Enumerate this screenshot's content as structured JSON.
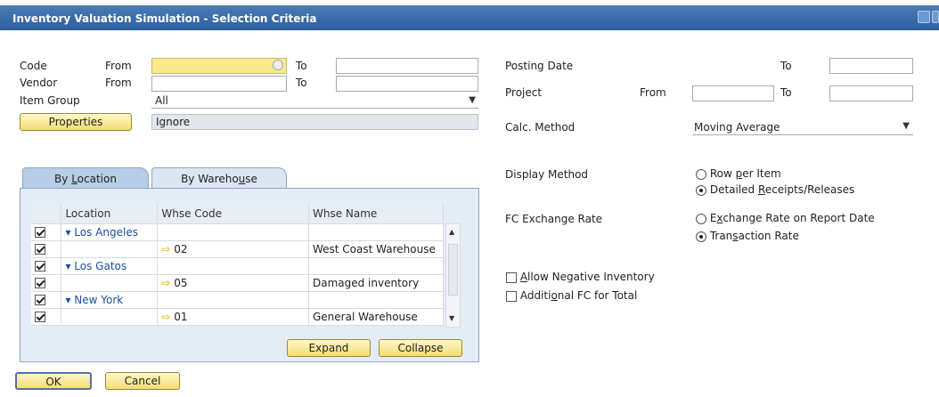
{
  "window": {
    "title": "Inventory Valuation Simulation - Selection Criteria"
  },
  "left": {
    "code_label": "Code",
    "code_from": "From",
    "code_to": "To",
    "vendor_label": "Vendor",
    "vendor_from": "From",
    "vendor_to": "To",
    "item_group_label": "Item Group",
    "item_group_value": "All",
    "properties_button": "Properties",
    "properties_value": "Ignore"
  },
  "tabs": [
    {
      "label_pre": "By ",
      "label_u": "L",
      "label_post": "ocation",
      "active": true
    },
    {
      "label_pre": "By Wareho",
      "label_u": "u",
      "label_post": "se",
      "active": false
    }
  ],
  "grid": {
    "columns": [
      "Location",
      "Whse Code",
      "Whse Name"
    ],
    "rows": [
      {
        "checked": true,
        "location": "Los Angeles",
        "code": "",
        "name": "",
        "group": true
      },
      {
        "checked": true,
        "location": "",
        "code": "02",
        "name": "West Coast Warehouse",
        "group": false
      },
      {
        "checked": true,
        "location": "Los Gatos",
        "code": "",
        "name": "",
        "group": true
      },
      {
        "checked": true,
        "location": "",
        "code": "05",
        "name": "Damaged inventory",
        "group": false
      },
      {
        "checked": true,
        "location": "New York",
        "code": "",
        "name": "",
        "group": true
      },
      {
        "checked": true,
        "location": "",
        "code": "01",
        "name": "General Warehouse",
        "group": false
      }
    ]
  },
  "buttons": {
    "expand": "Expand",
    "collapse": "Collapse",
    "ok": "OK",
    "cancel": "Cancel"
  },
  "right": {
    "posting_date_label": "Posting Date",
    "posting_to": "To",
    "project_label": "Project",
    "project_from": "From",
    "project_to": "To",
    "calc_method_label": "Calc. Method",
    "calc_method_value": "Moving Average",
    "display_method_label": "Display Method",
    "display_opt1_pre": "Row ",
    "display_opt1_u": "p",
    "display_opt1_post": "er Item",
    "display_opt2_pre": "Detailed ",
    "display_opt2_u": "R",
    "display_opt2_post": "eceipts/Releases",
    "fc_label": "FC Exchange Rate",
    "fc_opt1_pre": "E",
    "fc_opt1_u": "x",
    "fc_opt1_post": "change Rate on Report Date",
    "fc_opt2_pre": "Tran",
    "fc_opt2_u": "s",
    "fc_opt2_post": "action Rate",
    "allow_neg_pre": "",
    "allow_neg_u": "A",
    "allow_neg_post": "llow Negative Inventory",
    "add_fc_pre": "Additi",
    "add_fc_u": "o",
    "add_fc_post": "nal FC for Total"
  }
}
